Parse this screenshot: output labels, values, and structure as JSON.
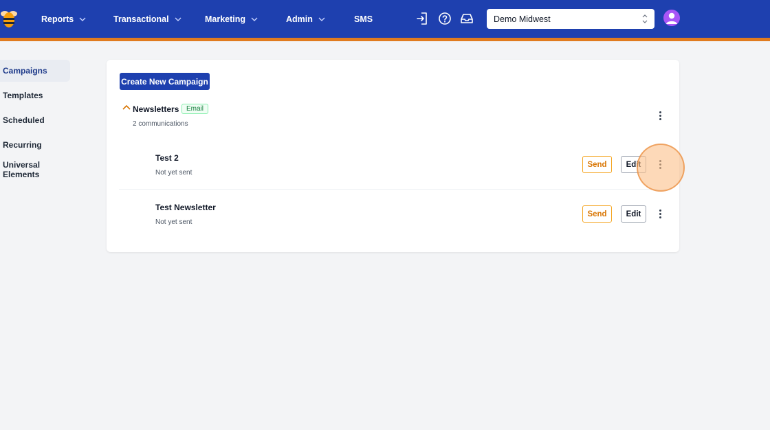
{
  "nav": {
    "items": [
      {
        "label": "Reports",
        "has_dropdown": true
      },
      {
        "label": "Transactional",
        "has_dropdown": true
      },
      {
        "label": "Marketing",
        "has_dropdown": true
      },
      {
        "label": "Admin",
        "has_dropdown": true
      },
      {
        "label": "SMS",
        "has_dropdown": false
      }
    ],
    "icons": [
      "sign-in-icon",
      "help-icon",
      "inbox-icon"
    ],
    "org_select": {
      "value": "Demo Midwest"
    },
    "colors": {
      "bar": "#1e40af",
      "stripe": "#e07b1f"
    }
  },
  "sidebar": {
    "items": [
      {
        "label": "Campaigns",
        "active": true
      },
      {
        "label": "Templates",
        "active": false
      },
      {
        "label": "Scheduled",
        "active": false
      },
      {
        "label": "Recurring",
        "active": false
      },
      {
        "label": "Universal Elements",
        "active": false
      }
    ]
  },
  "main": {
    "create_button": "Create New Campaign",
    "group": {
      "title": "Newsletters",
      "badge": "Email",
      "count": "2 communications",
      "expanded": true
    },
    "communications": [
      {
        "title": "Test 2",
        "status": "Not yet sent",
        "send_label": "Send",
        "edit_label": "Edit"
      },
      {
        "title": "Test Newsletter",
        "status": "Not yet sent",
        "send_label": "Send",
        "edit_label": "Edit"
      }
    ]
  }
}
